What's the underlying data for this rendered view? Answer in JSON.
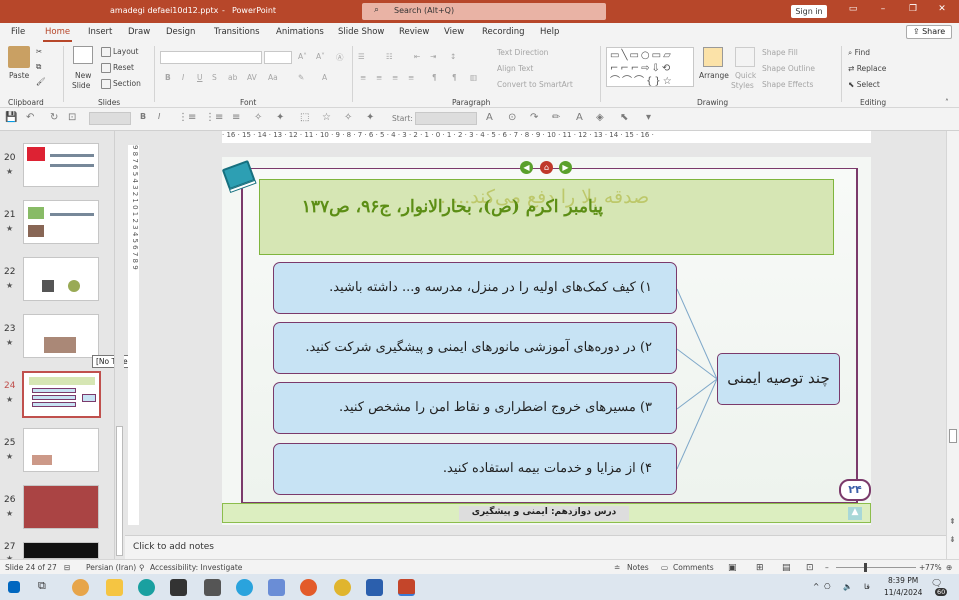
{
  "window": {
    "filename": "amadegi defaei10d12.pptx",
    "separator": "-",
    "app": "PowerPoint",
    "search_placeholder": "Search (Alt+Q)",
    "sign_in": "Sign in"
  },
  "tabs": [
    "File",
    "Home",
    "Insert",
    "Draw",
    "Design",
    "Transitions",
    "Animations",
    "Slide Show",
    "Review",
    "View",
    "Recording",
    "Help"
  ],
  "share": "Share",
  "ribbon": {
    "clipboard": {
      "paste": "Paste",
      "label": "Clipboard"
    },
    "slides": {
      "new_slide": "New",
      "new_slide2": "Slide",
      "layout": "Layout",
      "reset": "Reset",
      "section": "Section",
      "label": "Slides"
    },
    "font": {
      "label": "Font"
    },
    "paragraph": {
      "text_direction": "Text Direction",
      "align_text": "Align Text",
      "smartart": "Convert to SmartArt",
      "label": "Paragraph"
    },
    "drawing": {
      "arrange": "Arrange",
      "quick_styles": "Quick",
      "quick_styles2": "Styles",
      "shape_fill": "Shape Fill",
      "shape_outline": "Shape Outline",
      "shape_effects": "Shape Effects",
      "label": "Drawing"
    },
    "editing": {
      "find": "Find",
      "replace": "Replace",
      "select": "Select",
      "label": "Editing"
    }
  },
  "qat": {
    "start_label": "Start:"
  },
  "thumbnails": [
    {
      "num": "20",
      "star": "★"
    },
    {
      "num": "21",
      "star": "★"
    },
    {
      "num": "22",
      "star": "★"
    },
    {
      "num": "23",
      "star": "★"
    },
    {
      "num": "24",
      "star": "★"
    },
    {
      "num": "25",
      "star": "★"
    },
    {
      "num": "26",
      "star": "★"
    },
    {
      "num": "27",
      "star": "★"
    }
  ],
  "tooltip": "[No Title]",
  "ruler": {
    "h": "· 16 · 15 · 14 · 13 · 12 · 11 · 10 · 9 · 8 · 7 · 6 · 5 · 4 · 3 · 2 · 1 · 0 · 1 · 2 · 3 · 4 · 5 · 6 · 7 · 8 · 9 · 10 · 11 · 12 · 13 · 14 · 15 · 16 ·",
    "v": "9 8 7 6 5 4 3 2 1 0 1 2 3 4 5 6 7 8 9"
  },
  "slide": {
    "quote_line1": "صدقه بلا را دفع می‌کند... .",
    "quote_line2": "پیامبر اکرم (ص)، بحارالانوار، ج۹۶، ص۱۳۷",
    "items": [
      "۱) کیف کمک‌های اولیه را در منزل، مدرسه و... داشته باشید.",
      "۲) در دوره‌های آموزشی مانورهای ایمنی و پیشگیری شرکت کنید.",
      "۳) مسیرهای خروج اضطراری و نقاط امن را مشخص کنید.",
      "۴) از مزایا و خدمات بیمه استفاده کنید."
    ],
    "center": "چند توصیه ایمنی",
    "footer": "درس دوازدهم: ایمنی و پیشگیری",
    "page": "۲۴"
  },
  "notes_placeholder": "Click to add notes",
  "status": {
    "slide": "Slide 24 of 27",
    "language": "Persian (Iran)",
    "accessibility": "Accessibility: Investigate",
    "notes": "Notes",
    "comments": "Comments",
    "zoom": "77%"
  },
  "tray": {
    "lang": "فا",
    "time": "8:39 PM",
    "date": "11/4/2024",
    "badge": "60"
  }
}
